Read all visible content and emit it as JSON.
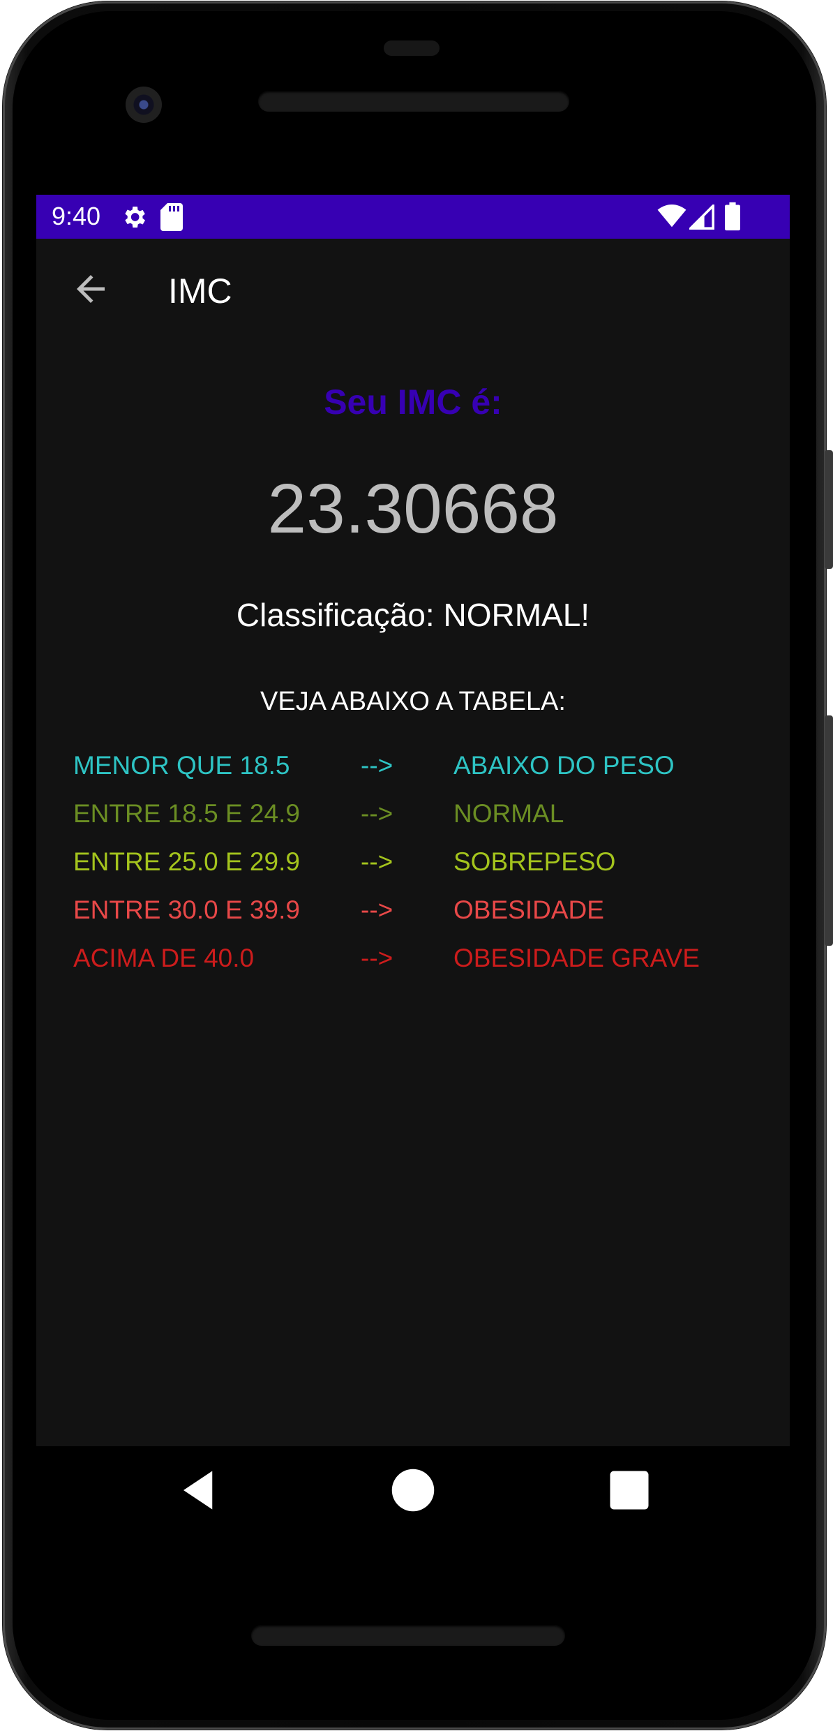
{
  "status_bar": {
    "time": "9:40",
    "icons": [
      "settings-icon",
      "sd-card-icon",
      "wifi-icon",
      "signal-icon",
      "battery-icon"
    ]
  },
  "app_bar": {
    "title": "IMC",
    "back_icon": "arrow-left-icon"
  },
  "result": {
    "heading": "Seu IMC é:",
    "value": "23.30668",
    "classification": "Classificação: NORMAL!"
  },
  "table": {
    "heading": "VEJA ABAIXO A TABELA:",
    "rows": [
      {
        "range": "MENOR QUE 18.5",
        "arrow": "-->",
        "class": "ABAIXO DO PESO",
        "color": "#2ec4c4"
      },
      {
        "range": "ENTRE 18.5 E 24.9",
        "arrow": "-->",
        "class": "NORMAL",
        "color": "#6b8e23"
      },
      {
        "range": "ENTRE 25.0 E 29.9",
        "arrow": "-->",
        "class": "SOBREPESO",
        "color": "#a4c41d"
      },
      {
        "range": "ENTRE 30.0 E 39.9",
        "arrow": "-->",
        "class": "OBESIDADE",
        "color": "#e84848"
      },
      {
        "range": "ACIMA DE 40.0",
        "arrow": "-->",
        "class": "OBESIDADE GRAVE",
        "color": "#cc1c1c"
      }
    ]
  },
  "nav_bar": {
    "buttons": [
      "back-triangle-icon",
      "home-circle-icon",
      "recents-square-icon"
    ]
  },
  "colors": {
    "status_bar": "#3700b3",
    "heading": "#3700b3",
    "background": "#121212",
    "value": "#bdbdbd"
  }
}
